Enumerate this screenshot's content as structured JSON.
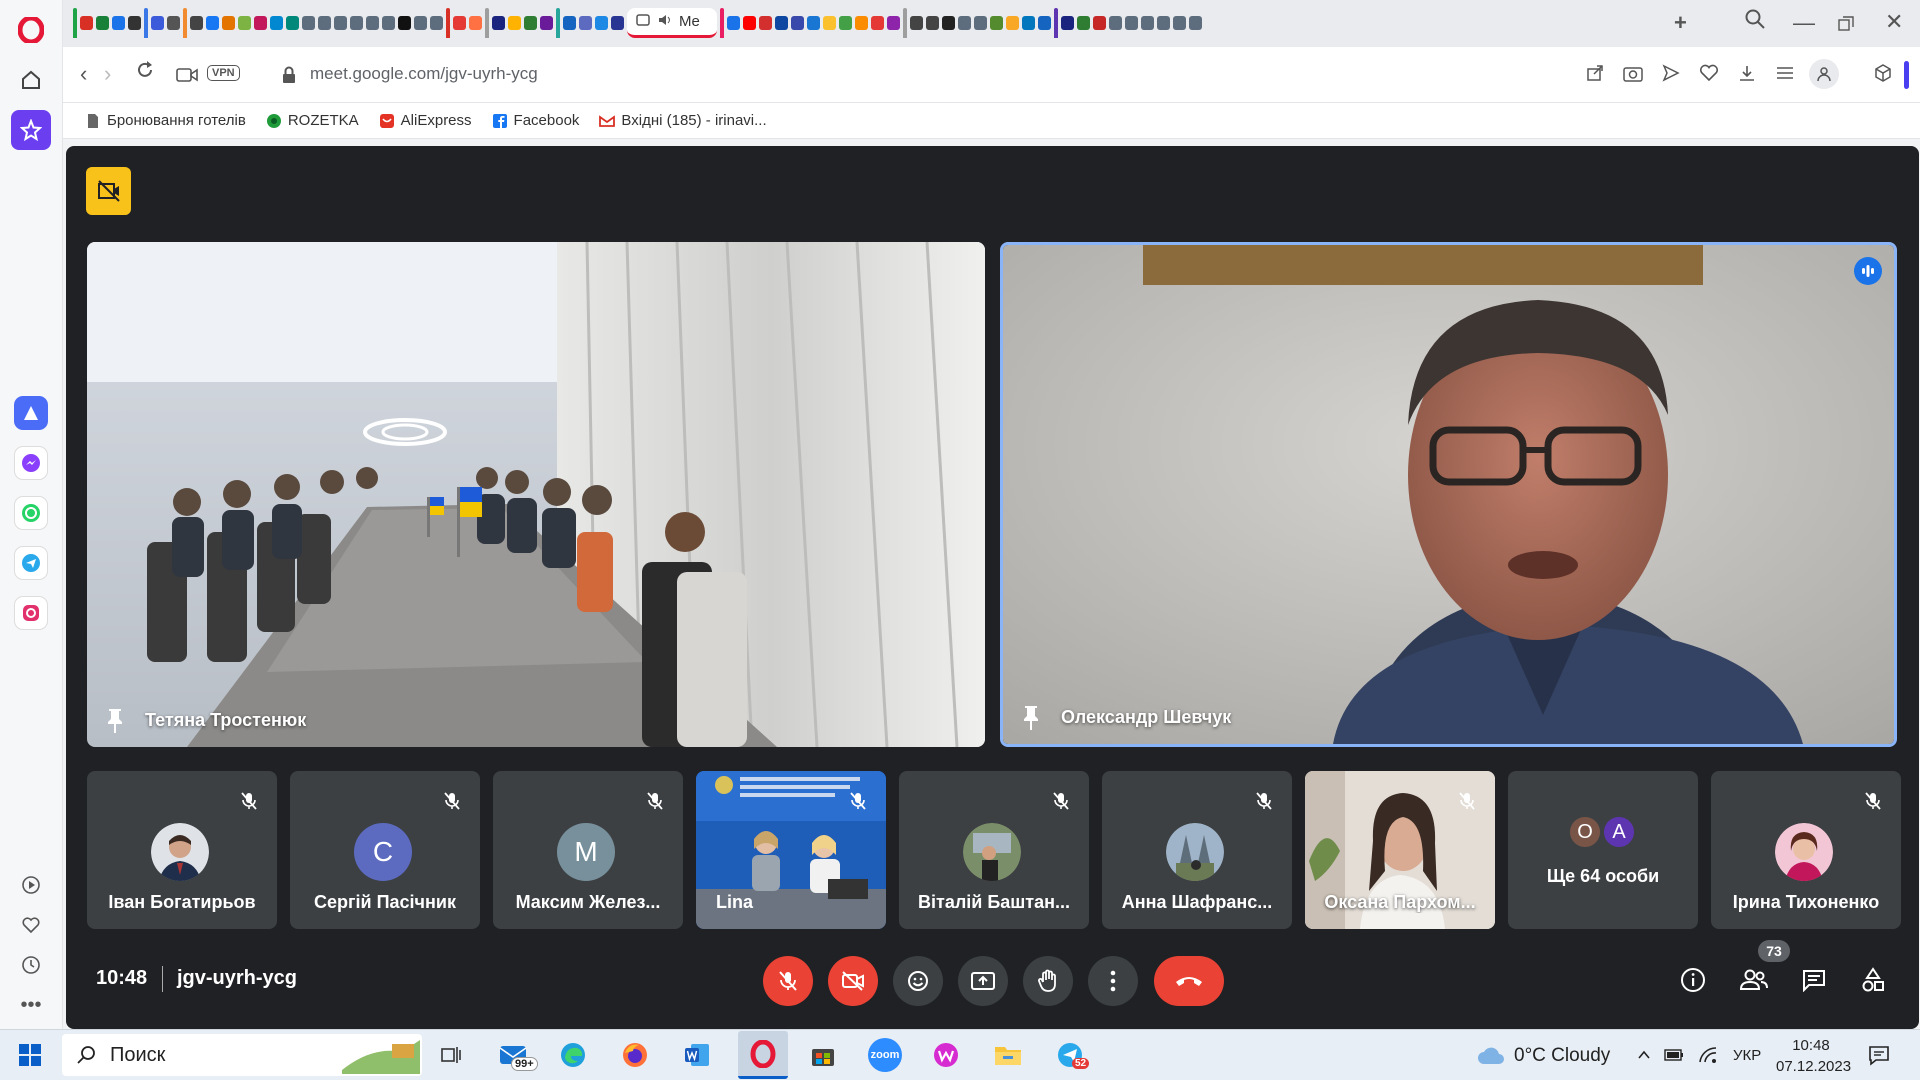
{
  "browser": {
    "active_tab_label": "Me",
    "url": "meet.google.com/jgv-uyrh-ycg",
    "vpn_label": "VPN",
    "bookmarks": [
      {
        "label": "Бронювання готелів",
        "color": "#555555"
      },
      {
        "label": "ROZETKA",
        "color": "#1f9b3a"
      },
      {
        "label": "AliExpress",
        "color": "#e43225"
      },
      {
        "label": "Facebook",
        "color": "#1877f2"
      },
      {
        "label": "Вхідні (185) - irinavi...",
        "color": "#d93025"
      }
    ]
  },
  "meet": {
    "main_tiles": [
      {
        "name": "Тетяна Тростенюк"
      },
      {
        "name": "Олександр Шевчук"
      }
    ],
    "participants": [
      {
        "name": "Іван Богатирьов",
        "initial": "",
        "avatar_color": "#6b7b8c"
      },
      {
        "name": "Сергій Пасічник",
        "initial": "С",
        "avatar_color": "#5c6bc0"
      },
      {
        "name": "Максим Желез...",
        "initial": "М",
        "avatar_color": "#78909c"
      },
      {
        "name": "Lina",
        "initial": "",
        "avatar_color": "#1565c0"
      },
      {
        "name": "Віталій Баштан...",
        "initial": "",
        "avatar_color": "#8d6e63"
      },
      {
        "name": "Анна Шафранс...",
        "initial": "",
        "avatar_color": "#607d8b"
      },
      {
        "name": "Оксана Пархом...",
        "initial": "",
        "avatar_color": "#d7ccc8"
      },
      {
        "name": "Ще 64 особи",
        "initial": "",
        "avatar_color": "#3c4043"
      },
      {
        "name": "Ірина Тихоненко",
        "initial": "",
        "avatar_color": "#e91e63"
      }
    ],
    "more_avatars": [
      {
        "initial": "О",
        "color": "#795548"
      },
      {
        "initial": "А",
        "color": "#5e35b1"
      }
    ],
    "time": "10:48",
    "meeting_code": "jgv-uyrh-ycg",
    "participants_count": "73"
  },
  "taskbar": {
    "search_placeholder": "Поиск",
    "notification_badge": "99+",
    "telegram_badge": "52",
    "zoom_label": "zoom",
    "weather": "0°C  Cloudy",
    "language": "УКР",
    "clock_time": "10:48",
    "clock_date": "07.12.2023"
  },
  "colors": {
    "meet_bg": "#202124",
    "tile_bg": "#3c4043",
    "hangup": "#ea4335",
    "active_speaker_border": "#8ab4f8"
  }
}
